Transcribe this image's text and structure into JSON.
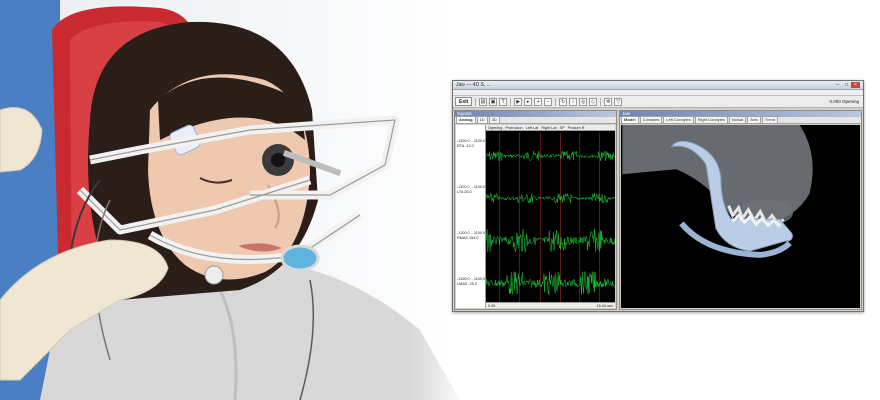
{
  "window": {
    "title": "Jaw — 4D S. ...",
    "status": "0.000 Opening"
  },
  "toolbar": {
    "exit_label": "Exit"
  },
  "left_pane": {
    "title": "Signals",
    "tabs": [
      "Analog",
      "1D",
      "3D"
    ],
    "event_tabs": [
      "Opening",
      "Protrusion",
      "Left Lat",
      "Right Lat",
      "SP",
      "Prosum R"
    ],
    "channels": [
      {
        "range": "-1100.0 .. 1100.0 uV",
        "name": "RTA",
        "value": "-12.0"
      },
      {
        "range": "-1100.0 .. 1100.0 uV",
        "name": "LTA",
        "value": "25.0"
      },
      {
        "range": "-1100.0 .. 1100.0 uV",
        "name": "RMAS",
        "value": "154.0"
      },
      {
        "range": "-1100.0 .. 1100.0 uV",
        "name": "LMAS",
        "value": "-25.0"
      }
    ],
    "time_start": "0.00",
    "time_end": "16.44 sec"
  },
  "right_pane": {
    "title": "Jaw",
    "tabs": [
      "Model",
      "Condyles",
      "Left Condyles",
      "Right Condyles",
      "Incisal",
      "Axis",
      "Trend"
    ]
  },
  "colors": {
    "signal": "#1fe23a",
    "marker": "#c0392b",
    "bone": "#b9cde6",
    "background_plot": "#000000"
  }
}
